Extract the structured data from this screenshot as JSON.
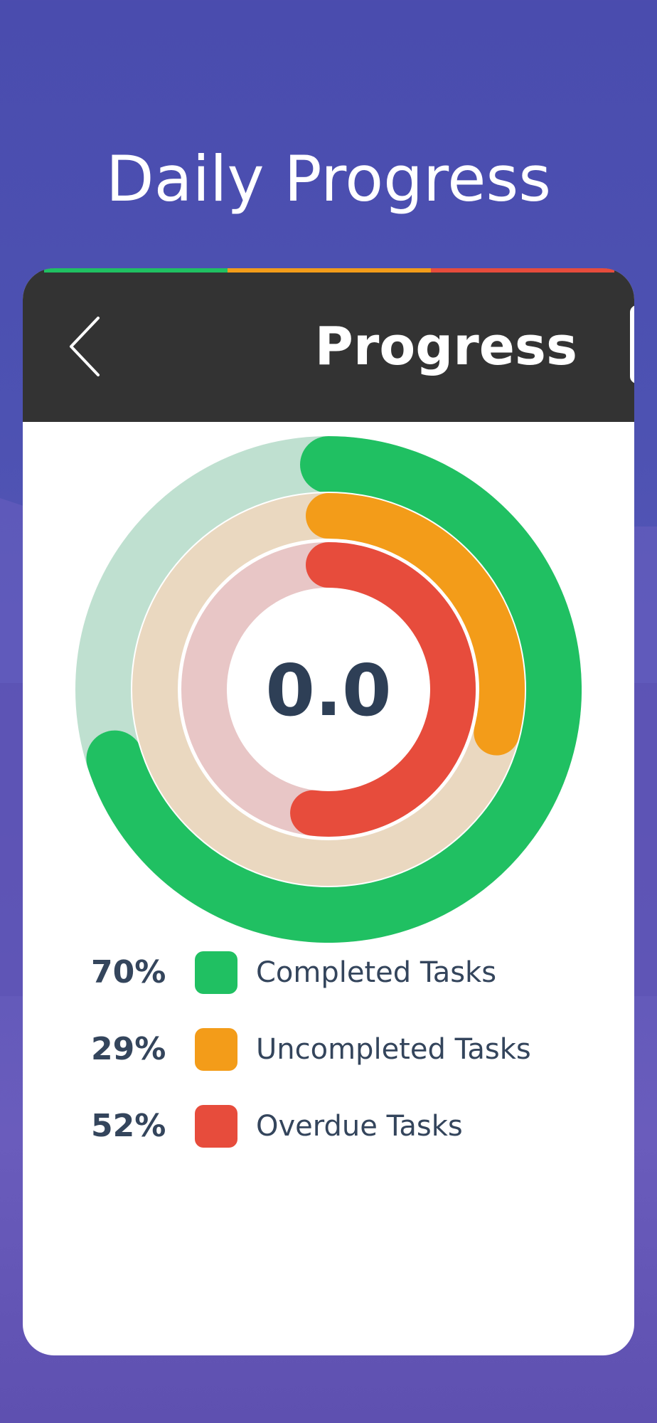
{
  "header": {
    "title": "Daily Progress"
  },
  "nav": {
    "title": "Progress",
    "back_icon": "chevron-left-icon"
  },
  "colors": {
    "completed": "#20c062",
    "uncompleted": "#f39c19",
    "overdue": "#e74c3c",
    "completed_track": "#bfe0d0",
    "uncompleted_track": "#ead8c0",
    "overdue_track": "#e8c6c6",
    "nav_bg": "#333333",
    "text": "#34455c"
  },
  "chart_data": {
    "type": "radial-bar",
    "center_label": "0.0",
    "series": [
      {
        "name": "Completed Tasks",
        "value": 70,
        "label": "70%"
      },
      {
        "name": "Uncompleted Tasks",
        "value": 29,
        "label": "29%"
      },
      {
        "name": "Overdue Tasks",
        "value": 52,
        "label": "52%"
      }
    ]
  }
}
